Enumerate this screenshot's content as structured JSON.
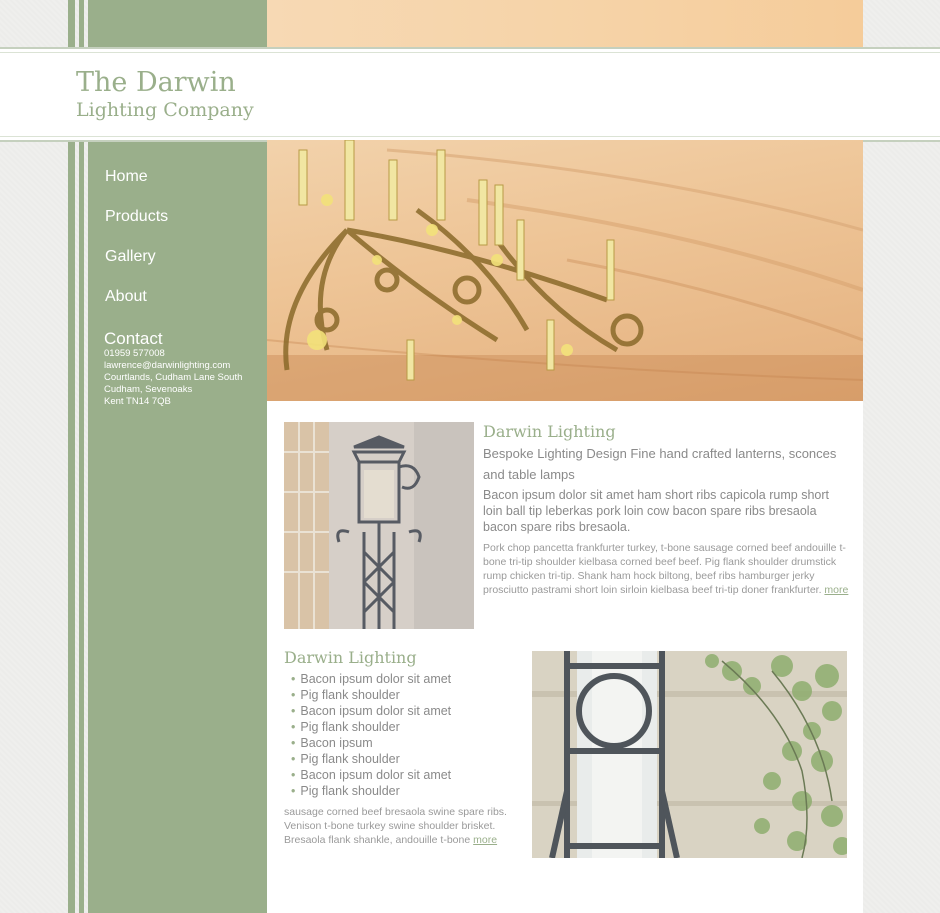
{
  "brand": {
    "title": "The Darwin",
    "subtitle": "Lighting Company",
    "color": "#9aaf8b"
  },
  "nav": {
    "items": [
      {
        "label": "Home"
      },
      {
        "label": "Products"
      },
      {
        "label": "Gallery"
      },
      {
        "label": "About"
      }
    ]
  },
  "contact": {
    "heading": "Contact",
    "lines": [
      "01959 577008",
      "lawrence@darwinlighting.com",
      "Courtlands, Cudham Lane South",
      "Cudham, Sevenoaks",
      "Kent TN14 7QB"
    ]
  },
  "section1": {
    "heading": "Darwin Lighting",
    "lead": "Bespoke Lighting Design Fine hand crafted lanterns, sconces and table lamps",
    "intro": "Bacon ipsum dolor sit amet ham short ribs capicola rump short loin ball tip leberkas pork loin cow bacon spare ribs bresaola bacon spare ribs bresaola.",
    "body": "Pork chop pancetta frankfurter turkey, t-bone sausage corned beef andouille t-bone tri-tip shoulder kielbasa corned beef beef. Pig flank shoulder drumstick rump chicken tri-tip. Shank ham hock biltong, beef ribs hamburger jerky prosciutto pastrami short loin sirloin kielbasa beef tri-tip doner frankfurter.",
    "more": "more"
  },
  "section2": {
    "heading": "Darwin Lighting",
    "list": [
      "Bacon ipsum dolor sit amet",
      "Pig flank shoulder",
      "Bacon ipsum dolor sit amet",
      "Pig flank shoulder",
      "Bacon ipsum",
      "Pig flank shoulder",
      "Bacon ipsum dolor sit amet",
      "Pig flank shoulder"
    ],
    "body": "sausage corned beef bresaola swine spare ribs. Venison t-bone turkey swine shoulder brisket. Bresaola flank shankle, andouille t-bone",
    "more": "more"
  },
  "colors": {
    "sage": "#9aaf8b",
    "peach": "#f5cfa2",
    "text": "#8a8a8a"
  }
}
